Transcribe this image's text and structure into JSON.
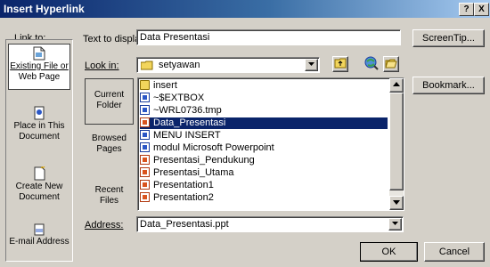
{
  "window": {
    "title": "Insert Hyperlink",
    "help_button": "?",
    "close_button": "X"
  },
  "link_to": {
    "label": "Link to:",
    "items": [
      {
        "label_line1": "Existing File or",
        "label_line2": "Web Page",
        "icon": "file-icon"
      },
      {
        "label_line1": "Place in This",
        "label_line2": "Document",
        "icon": "document-place-icon"
      },
      {
        "label_line1": "Create New",
        "label_line2": "Document",
        "icon": "new-document-icon"
      },
      {
        "label_line1": "E-mail Address",
        "label_line2": "",
        "icon": "email-icon"
      }
    ]
  },
  "text_to_display": {
    "label": "Text to display:",
    "value": "Data Presentasi"
  },
  "screentip_button": "ScreenTip...",
  "look_in": {
    "label": "Look in:",
    "value": "setyawan"
  },
  "places": [
    {
      "line1": "Current",
      "line2": "Folder"
    },
    {
      "line1": "Browsed",
      "line2": "Pages"
    },
    {
      "line1": "Recent",
      "line2": "Files"
    }
  ],
  "files": [
    {
      "name": "insert",
      "type": "folder"
    },
    {
      "name": "~$EXTBOX",
      "type": "word"
    },
    {
      "name": "~WRL0736.tmp",
      "type": "tmp"
    },
    {
      "name": "Data_Presentasi",
      "type": "ppt",
      "selected": true
    },
    {
      "name": "MENU INSERT",
      "type": "word"
    },
    {
      "name": "modul Microsoft Powerpoint",
      "type": "word"
    },
    {
      "name": "Presentasi_Pendukung",
      "type": "ppt"
    },
    {
      "name": "Presentasi_Utama",
      "type": "ppt"
    },
    {
      "name": "Presentation1",
      "type": "ppt"
    },
    {
      "name": "Presentation2",
      "type": "ppt"
    }
  ],
  "bookmark_button": "Bookmark...",
  "address": {
    "label": "Address:",
    "value": "Data_Presentasi.ppt"
  },
  "ok_button": "OK",
  "cancel_button": "Cancel",
  "colors": {
    "title_gradient_start": "#0a246a",
    "selection": "#0a246a",
    "dialog_face": "#d4d0c8"
  }
}
